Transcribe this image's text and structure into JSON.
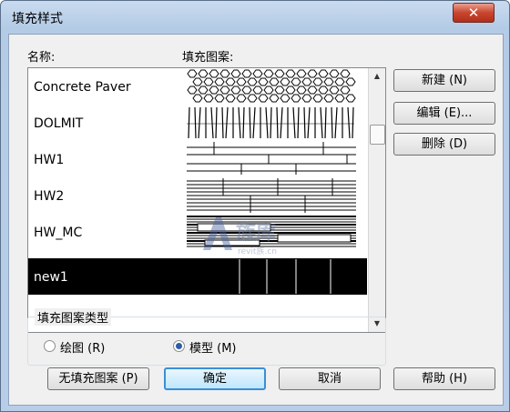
{
  "window": {
    "title": "填充样式",
    "close_glyph": "✕"
  },
  "list": {
    "header_name": "名称:",
    "header_pattern": "填充图案:",
    "items": [
      {
        "name": "Concrete Paver",
        "pattern": "cobble",
        "selected": false
      },
      {
        "name": "DOLMIT",
        "pattern": "vlines",
        "selected": false
      },
      {
        "name": "HW1",
        "pattern": "hw1",
        "selected": false
      },
      {
        "name": "HW2",
        "pattern": "hw2",
        "selected": false
      },
      {
        "name": "HW_MC",
        "pattern": "hwmc",
        "selected": false
      },
      {
        "name": "new1",
        "pattern": "new1",
        "selected": true
      }
    ]
  },
  "side_buttons": {
    "new": "新建 (N)",
    "edit": "编辑 (E)...",
    "delete": "删除 (D)"
  },
  "pattern_type": {
    "group_label": "填充图案类型",
    "options": [
      {
        "label": "绘图 (R)",
        "checked": false
      },
      {
        "label": "模型 (M)",
        "checked": true
      }
    ]
  },
  "bottom_buttons": {
    "no_fill": "无填充图案 (P)",
    "ok": "确定",
    "cancel": "取消",
    "help": "帮助 (H)"
  },
  "watermark": {
    "text": "族库",
    "sub": "revit族.cn"
  }
}
